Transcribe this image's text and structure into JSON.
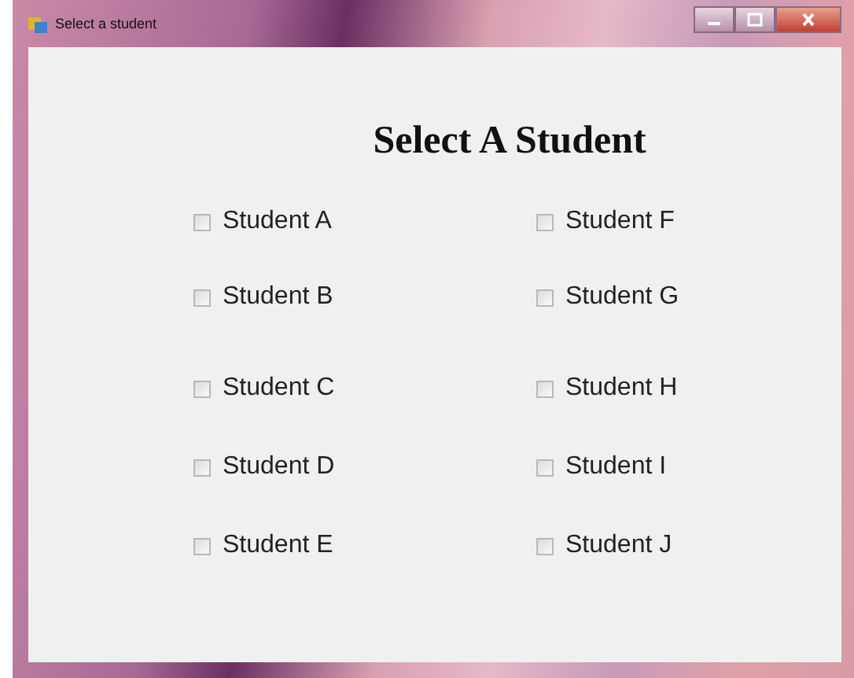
{
  "window": {
    "title": "Select a student"
  },
  "heading": "Select A Student",
  "students": [
    {
      "label": "Student A",
      "checked": false
    },
    {
      "label": "Student B",
      "checked": false
    },
    {
      "label": "Student C",
      "checked": false
    },
    {
      "label": "Student D",
      "checked": false
    },
    {
      "label": "Student E",
      "checked": false
    },
    {
      "label": "Student F",
      "checked": false
    },
    {
      "label": "Student G",
      "checked": false
    },
    {
      "label": "Student H",
      "checked": false
    },
    {
      "label": "Student I",
      "checked": false
    },
    {
      "label": "Student J",
      "checked": false
    }
  ]
}
